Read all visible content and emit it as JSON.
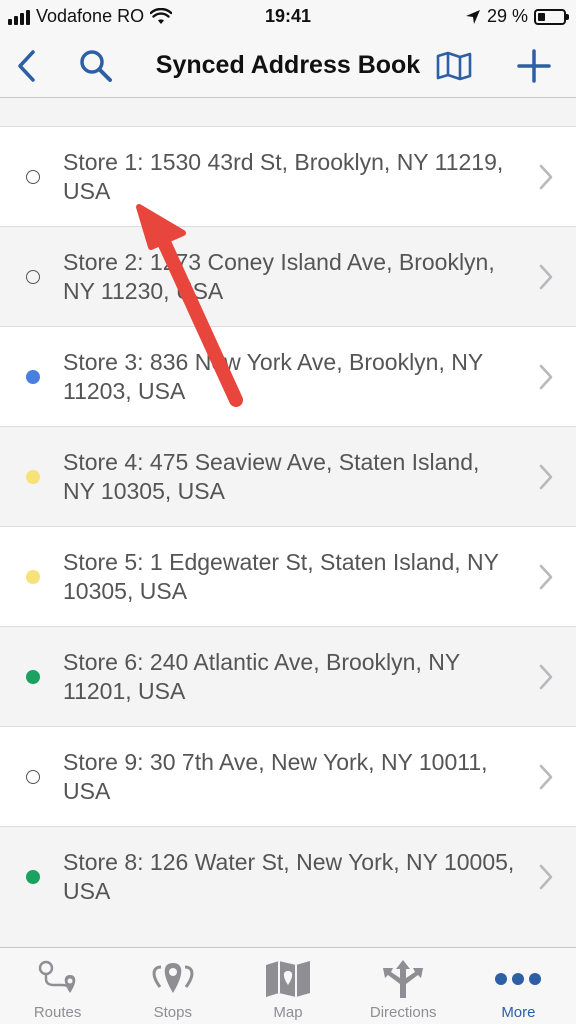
{
  "status_bar": {
    "carrier": "Vodafone RO",
    "time": "19:41",
    "battery": "29 %",
    "battery_level": 0.29
  },
  "nav": {
    "title": "Synced Address Book",
    "back_icon": "chevron-left-icon",
    "search_icon": "search-icon",
    "map_icon": "map-icon",
    "add_icon": "plus-icon",
    "accent": "#2d5fa4"
  },
  "addresses": [
    {
      "text": "Store 1: 1530 43rd St, Brooklyn, NY 11219, USA",
      "dot": "hollow",
      "color": ""
    },
    {
      "text": "Store 2: 1273 Coney Island Ave, Brooklyn, NY 11230, USA",
      "dot": "hollow",
      "color": ""
    },
    {
      "text": "Store 3: 836 New York Ave, Brooklyn, NY 11203, USA",
      "dot": "filled",
      "color": "#4a7fe0"
    },
    {
      "text": "Store 4: 475 Seaview Ave, Staten Island, NY 10305, USA",
      "dot": "filled",
      "color": "#f7e27a"
    },
    {
      "text": "Store 5: 1 Edgewater St, Staten Island, NY 10305, USA",
      "dot": "filled",
      "color": "#f7e27a"
    },
    {
      "text": "Store 6: 240 Atlantic Ave, Brooklyn, NY 11201, USA",
      "dot": "filled",
      "color": "#1aa260"
    },
    {
      "text": "Store 9: 30 7th Ave, New York, NY 10011, USA",
      "dot": "hollow",
      "color": ""
    },
    {
      "text": "Store 8: 126 Water St, New York, NY 10005, USA",
      "dot": "filled",
      "color": "#1aa260"
    }
  ],
  "annotation": {
    "color": "#e8453c"
  },
  "tabs": [
    {
      "label": "Routes",
      "icon": "routes-icon",
      "active": false
    },
    {
      "label": "Stops",
      "icon": "stops-icon",
      "active": false
    },
    {
      "label": "Map",
      "icon": "map-icon",
      "active": false
    },
    {
      "label": "Directions",
      "icon": "directions-icon",
      "active": false
    },
    {
      "label": "More",
      "icon": "more-icon",
      "active": true
    }
  ]
}
